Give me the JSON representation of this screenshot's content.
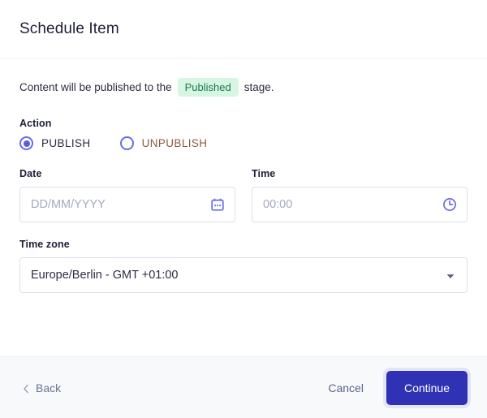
{
  "header": {
    "title": "Schedule Item"
  },
  "body": {
    "info": {
      "prefix": "Content will be published to the",
      "badge": "Published",
      "suffix": "stage."
    },
    "action": {
      "label": "Action",
      "options": [
        {
          "label": "PUBLISH",
          "selected": true
        },
        {
          "label": "UNPUBLISH",
          "selected": false
        }
      ]
    },
    "date": {
      "label": "Date",
      "value": "",
      "placeholder": "DD/MM/YYYY",
      "icon": "calendar-icon"
    },
    "time": {
      "label": "Time",
      "value": "",
      "placeholder": "00:00",
      "icon": "clock-icon"
    },
    "timezone": {
      "label": "Time zone",
      "value": "Europe/Berlin - GMT +01:00",
      "icon": "chevron-down-icon"
    }
  },
  "footer": {
    "back": "Back",
    "cancel": "Cancel",
    "continue": "Continue"
  },
  "colors": {
    "accent": "#2F32B4",
    "radio": "#5C5CE0",
    "icon": "#6B6BE8",
    "badge_bg": "#D7F5E3",
    "badge_text": "#1B7A4B",
    "unpublish_text": "#8B5A3C",
    "footer_bg": "#F8F9FB",
    "border": "#DCDFE8",
    "placeholder": "#A5AAC0"
  }
}
